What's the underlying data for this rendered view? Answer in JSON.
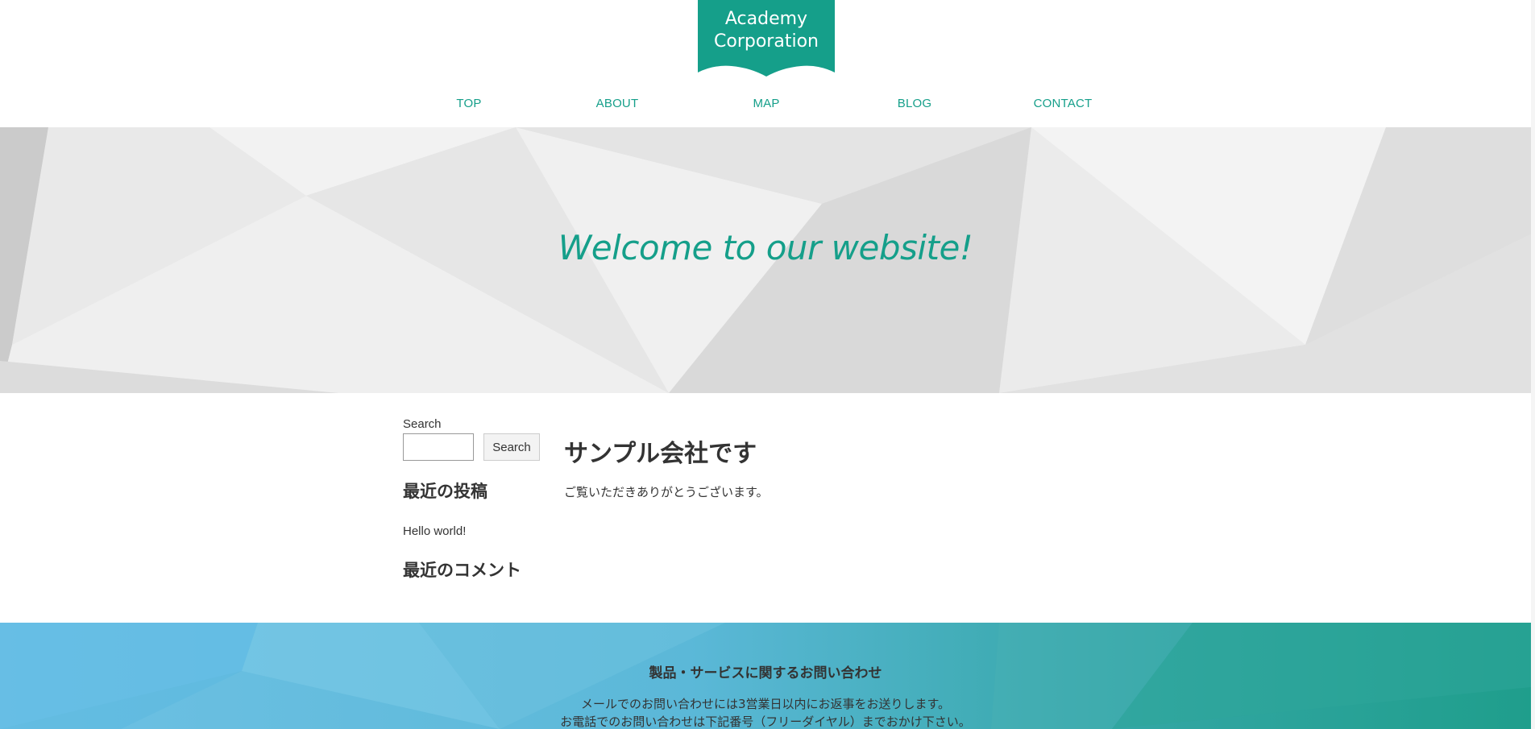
{
  "logo": {
    "text": "Academy\nCorporation",
    "color": "#159f8a"
  },
  "nav": {
    "items": [
      {
        "label": "TOP"
      },
      {
        "label": "ABOUT"
      },
      {
        "label": "MAP"
      },
      {
        "label": "BLOG"
      },
      {
        "label": "CONTACT"
      }
    ],
    "color": "#159f8a"
  },
  "hero": {
    "title": "Welcome to our website!"
  },
  "sidebar": {
    "search_label": "Search",
    "search_value": "",
    "search_button": "Search",
    "recent_posts_heading": "最近の投稿",
    "recent_posts": [
      "Hello world!"
    ],
    "recent_comments_heading": "最近のコメント"
  },
  "main": {
    "title": "サンプル会社です",
    "text": "ご覧いただきありがとうございます。"
  },
  "footer": {
    "title": "製品・サービスに関するお問い合わせ",
    "line1": "メールでのお問い合わせには3営業日以内にお返事をお送りします。",
    "line2": "お電話でのお問い合わせは下記番号（フリーダイヤル）までおかけ下さい。"
  }
}
